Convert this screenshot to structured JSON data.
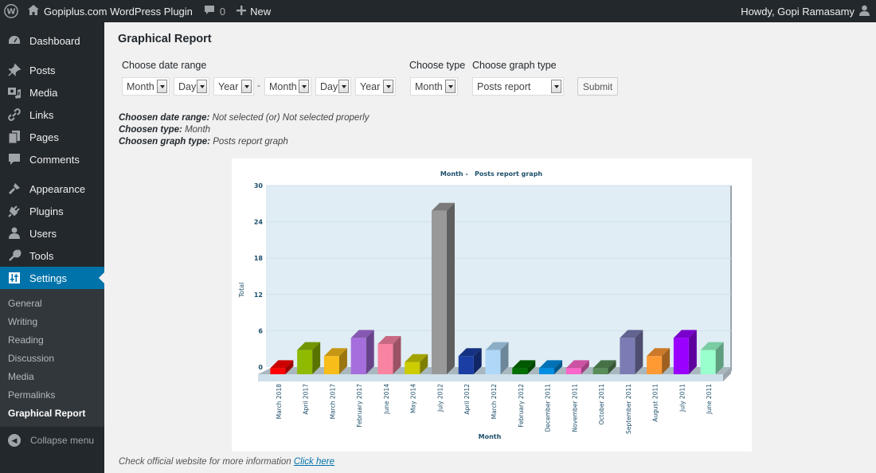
{
  "adminbar": {
    "site_name": "Gopiplus.com WordPress Plugin",
    "comments_count": "0",
    "new_label": "New",
    "howdy": "Howdy, Gopi Ramasamy"
  },
  "menu": {
    "items": [
      {
        "label": "Dashboard",
        "icon": "dashboard-icon"
      },
      {
        "label": "Posts",
        "icon": "pin-icon"
      },
      {
        "label": "Media",
        "icon": "media-icon"
      },
      {
        "label": "Links",
        "icon": "link-icon"
      },
      {
        "label": "Pages",
        "icon": "pages-icon"
      },
      {
        "label": "Comments",
        "icon": "comment-icon"
      },
      {
        "label": "Appearance",
        "icon": "brush-icon"
      },
      {
        "label": "Plugins",
        "icon": "plug-icon"
      },
      {
        "label": "Users",
        "icon": "user-icon"
      },
      {
        "label": "Tools",
        "icon": "wrench-icon"
      },
      {
        "label": "Settings",
        "icon": "settings-icon"
      }
    ],
    "submenu": [
      "General",
      "Writing",
      "Reading",
      "Discussion",
      "Media",
      "Permalinks",
      "Graphical Report"
    ],
    "collapse_label": "Collapse menu"
  },
  "page": {
    "title": "Graphical Report",
    "date_range_label": "Choose date range",
    "type_label": "Choose type",
    "graph_type_label": "Choose graph type",
    "from": {
      "month": "Month",
      "day": "Day",
      "year": "Year"
    },
    "separator": "-",
    "to": {
      "month": "Month",
      "day": "Day",
      "year": "Year"
    },
    "type_value": "Month",
    "graph_type_value": "Posts report",
    "submit_label": "Submit",
    "info": [
      {
        "label": "Choosen date range:",
        "value": " Not selected (or) Not selected properly"
      },
      {
        "label": "Choosen type:",
        "value": " Month"
      },
      {
        "label": "Choosen graph type:",
        "value": " Posts report graph"
      }
    ],
    "footer_text": "Check official website for more information ",
    "footer_link": "Click here"
  },
  "chart_data": {
    "type": "bar",
    "title": "Month -   Posts report graph",
    "xlabel": "Month",
    "ylabel": "Total",
    "ylim": [
      0,
      30
    ],
    "yticks": [
      0,
      6,
      12,
      18,
      24,
      30
    ],
    "grid": true,
    "categories": [
      "March 2018",
      "April 2017",
      "March 2017",
      "February 2017",
      "June 2014",
      "May 2014",
      "July 2012",
      "April 2012",
      "March 2012",
      "February 2012",
      "December 2011",
      "November 2011",
      "October 2011",
      "September 2011",
      "August 2011",
      "July 2011",
      "June 2011"
    ],
    "values": [
      1,
      4,
      3,
      6,
      5,
      2,
      27,
      3,
      4,
      1,
      1,
      1,
      1,
      6,
      3,
      6,
      4
    ],
    "colors": [
      "#ff0000",
      "#8fba00",
      "#f8bd19",
      "#a66edd",
      "#f984a1",
      "#cccc00",
      "#999999",
      "#1a3ea3",
      "#afd8f8",
      "#006f00",
      "#008ee4",
      "#ff66cc",
      "#588d59",
      "#7c7cb4",
      "#ff9933",
      "#9900ff",
      "#99ffcc"
    ]
  }
}
